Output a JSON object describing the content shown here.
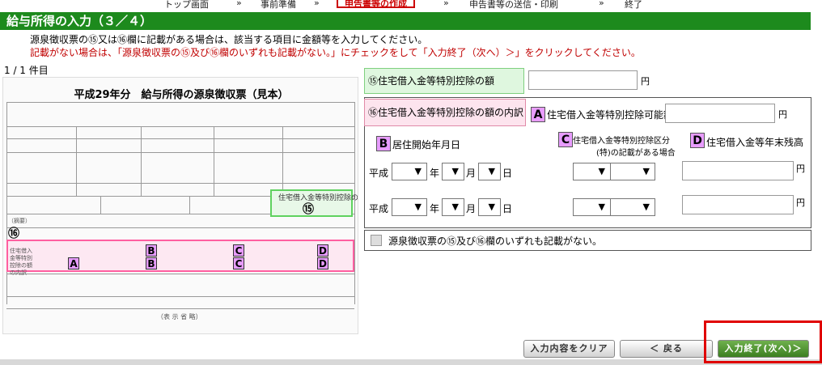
{
  "breadcrumb": [
    "トップ画面",
    "»",
    "事前準備",
    "»",
    "申告書等の作成",
    "»",
    "申告書等の送信・印刷",
    "»",
    "終了"
  ],
  "title": "給与所得の入力（３／４）",
  "instructions": {
    "line1": "源泉徴収票の⑮又は⑯欄に記載がある場合は、該当する項目に金額等を入力してください。",
    "line2": "記載がない場合は、「源泉徴収票の⑮及び⑯欄のいずれも記載がない。」にチェックをして「入力終了（次へ）＞」をクリックしてください。"
  },
  "item_count": "1 / 1 件目",
  "sample_form": {
    "title": "平成29年分　給与所得の源泉徴収票（見本）",
    "circle15": "⑮",
    "circle16": "⑯",
    "green_label": "住宅借入金等特別控除の額",
    "tekiyo": "（摘要）",
    "badges": {
      "a": "A",
      "b": "B",
      "c": "C",
      "d": "D"
    },
    "pink_row_label": "住宅借入金等特別控除の額の内訳",
    "bottom_note": "（表 示 省 略）"
  },
  "section15": {
    "label": "⑮住宅借入金等特別控除の額",
    "unit": "円",
    "value": ""
  },
  "section16": {
    "label": "⑯住宅借入金等特別控除の額の内訳",
    "a_badge": "A",
    "a_label": "住宅借入金等特別控除可能額",
    "a_unit": "円",
    "b_badge": "B",
    "b_label": "居住開始年月日",
    "c_badge": "C",
    "c_label_1": "住宅借入金等特別控除区分",
    "c_label_2": "(特)の記載がある場合",
    "d_badge": "D",
    "d_label": "住宅借入金等年末残高",
    "rows": [
      {
        "era": "平成",
        "year_unit": "年",
        "month_unit": "月",
        "day_unit": "日",
        "arrow": "▼",
        "unit": "円"
      },
      {
        "era": "平成",
        "year_unit": "年",
        "month_unit": "月",
        "day_unit": "日",
        "arrow": "▼",
        "unit": "円"
      }
    ]
  },
  "no_entry": {
    "label": "源泉徴収票の⑮及び⑯欄のいずれも記載がない。",
    "checked": false
  },
  "buttons": {
    "clear": "入力内容をクリア",
    "back": "＜ 戻る",
    "next": "入力終了(次へ)＞"
  },
  "colors": {
    "title_green": "#1d8a1d",
    "warning_red": "#c00000",
    "badge_purple": "#e89cff",
    "highlight_red": "#e00000"
  }
}
